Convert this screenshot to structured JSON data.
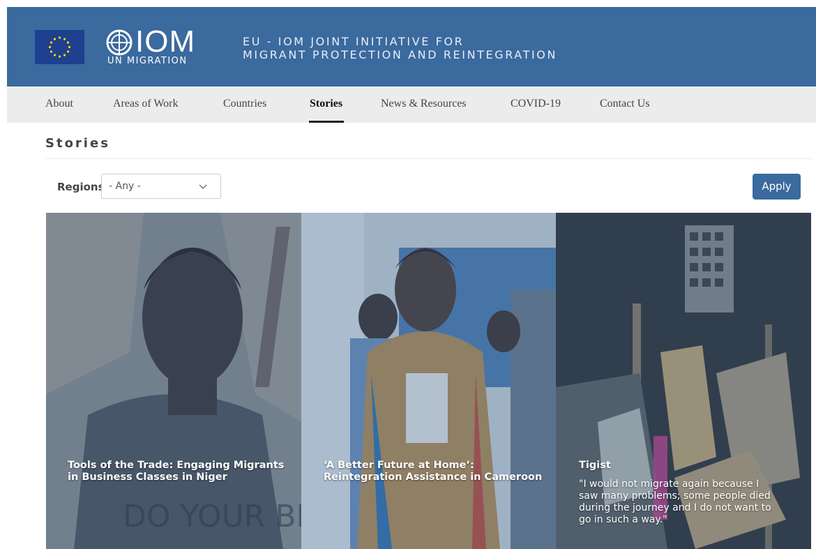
{
  "header": {
    "logo_word": "IOM",
    "logo_sub": "UN MIGRATION",
    "title_line1": "EU - IOM JOINT INITIATIVE FOR",
    "title_line2": "MIGRANT PROTECTION AND REINTEGRATION",
    "colors": {
      "header_bg": "#3a6a9e",
      "eu_blue": "#1f3f8f",
      "eu_stars": "#f5d90a"
    }
  },
  "nav": {
    "items": [
      {
        "label": "About"
      },
      {
        "label": "Areas of Work"
      },
      {
        "label": "Countries"
      },
      {
        "label": "Stories"
      },
      {
        "label": "News & Resources"
      },
      {
        "label": "COVID-19"
      },
      {
        "label": "Contact Us"
      }
    ],
    "active": "Stories"
  },
  "page": {
    "title": "Stories"
  },
  "filter": {
    "regions_label": "Regions",
    "regions_value": "- Any -",
    "apply_label": "Apply"
  },
  "stories": [
    {
      "title_line1": "Tools of the Trade: Engaging Migrants",
      "title_line2": "in Business Classes in Niger"
    },
    {
      "title_line1": "‘A Better Future at Home’:",
      "title_line2": "Reintegration Assistance in Cameroon"
    },
    {
      "title_line1": "Tigist",
      "quote_line1": "\"I would not migrate again because I",
      "quote_line2": "saw many problems; some people died",
      "quote_line3": "during the journey and I do not want to",
      "quote_line4": "go in such a way.\""
    }
  ]
}
